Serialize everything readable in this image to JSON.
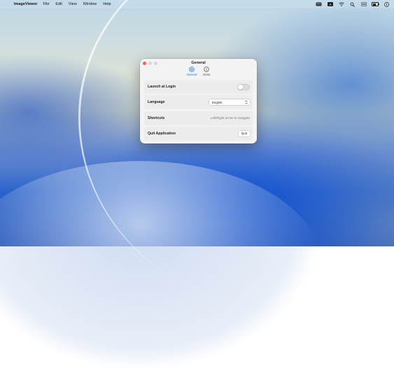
{
  "menubar": {
    "app_name": "ImageViewer",
    "menus": [
      "File",
      "Edit",
      "View",
      "Window",
      "Help"
    ],
    "status_icons": [
      "keyboard-badge-icon",
      "text-input-icon",
      "wifi-icon",
      "search-icon",
      "control-center-icon",
      "battery-icon",
      "siri-icon"
    ],
    "keyboard_badge": "A"
  },
  "window": {
    "title": "General",
    "tabs": [
      {
        "label": "General",
        "icon": "gear-icon",
        "active": true
      },
      {
        "label": "About",
        "icon": "info-icon",
        "active": false
      }
    ],
    "rows": {
      "launch": {
        "label": "Launch at Login",
        "enabled": false
      },
      "language": {
        "label": "Language",
        "value": "English"
      },
      "shortcuts": {
        "label": "Shortcuts",
        "hint": "Left/Right arrow to navigate"
      },
      "quit": {
        "label": "Quit Application",
        "button": "Quit"
      }
    }
  },
  "colors": {
    "accent": "#1a7bf0",
    "close": "#fe5f57",
    "minimize": "#d7d7d7",
    "zoom": "#d7d7d7"
  }
}
